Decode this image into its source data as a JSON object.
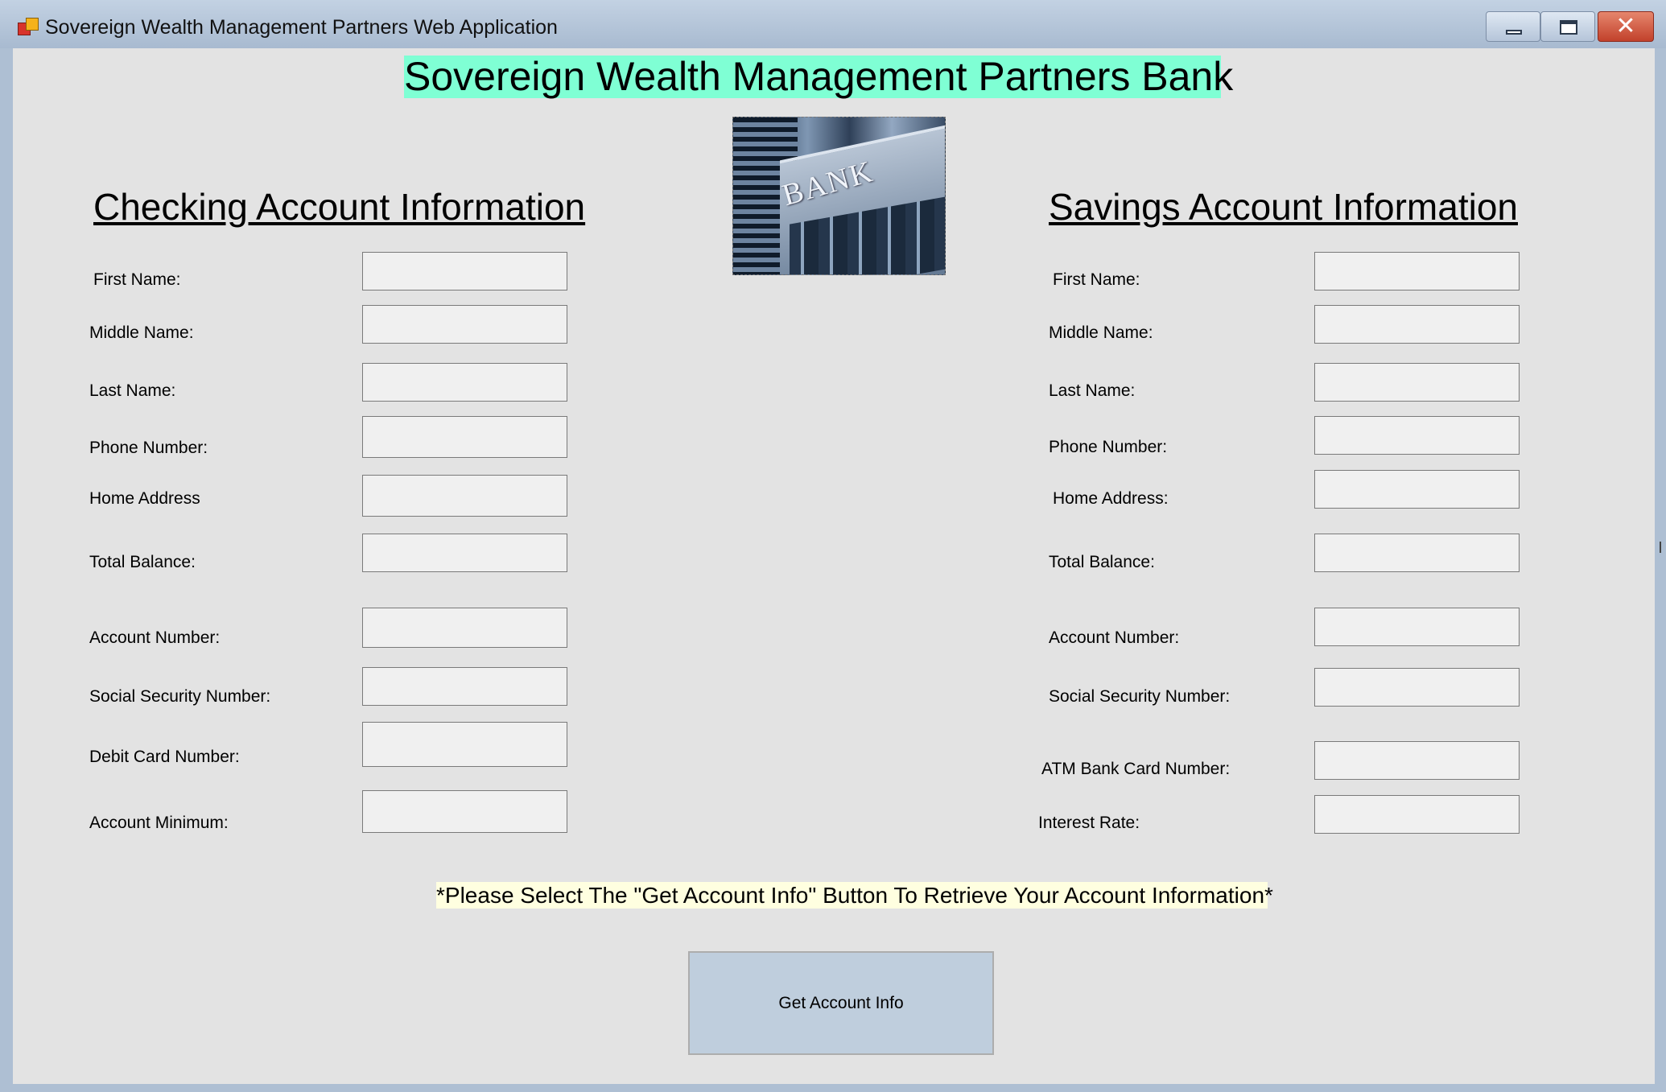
{
  "window": {
    "title": "Sovereign Wealth Management Partners Web Application",
    "controls": [
      "minimize",
      "maximize",
      "close"
    ],
    "close_glyph": "✕"
  },
  "header": {
    "title": "Sovereign Wealth Management Partners Bank",
    "title_background": "#7fffd4"
  },
  "image": {
    "sign_text": "BANK",
    "icon_name": "bank-building-photo"
  },
  "checking": {
    "heading": "Checking Account Information",
    "fields": [
      {
        "label": "First Name:",
        "value": ""
      },
      {
        "label": "Middle Name:",
        "value": ""
      },
      {
        "label": "Last Name:",
        "value": ""
      },
      {
        "label": "Phone Number:",
        "value": ""
      },
      {
        "label": "Home Address",
        "value": ""
      },
      {
        "label": "Total Balance:",
        "value": ""
      },
      {
        "label": "Account Number:",
        "value": ""
      },
      {
        "label": "Social Security Number:",
        "value": ""
      },
      {
        "label": "Debit Card Number:",
        "value": ""
      },
      {
        "label": "Account Minimum:",
        "value": ""
      }
    ]
  },
  "savings": {
    "heading": "Savings Account Information",
    "fields": [
      {
        "label": "First Name:",
        "value": ""
      },
      {
        "label": "Middle Name:",
        "value": ""
      },
      {
        "label": "Last Name:",
        "value": ""
      },
      {
        "label": "Phone Number:",
        "value": ""
      },
      {
        "label": "Home Address:",
        "value": ""
      },
      {
        "label": "Total Balance:",
        "value": ""
      },
      {
        "label": "Account Number:",
        "value": ""
      },
      {
        "label": "Social Security Number:",
        "value": ""
      },
      {
        "label": "ATM Bank Card Number:",
        "value": ""
      },
      {
        "label": "Interest Rate:",
        "value": ""
      }
    ]
  },
  "notice": {
    "text": "*Please Select The \"Get Account Info\" Button To Retrieve Your Account Information*",
    "background": "#ffffe0"
  },
  "actions": {
    "get_info_label": "Get Account Info"
  }
}
